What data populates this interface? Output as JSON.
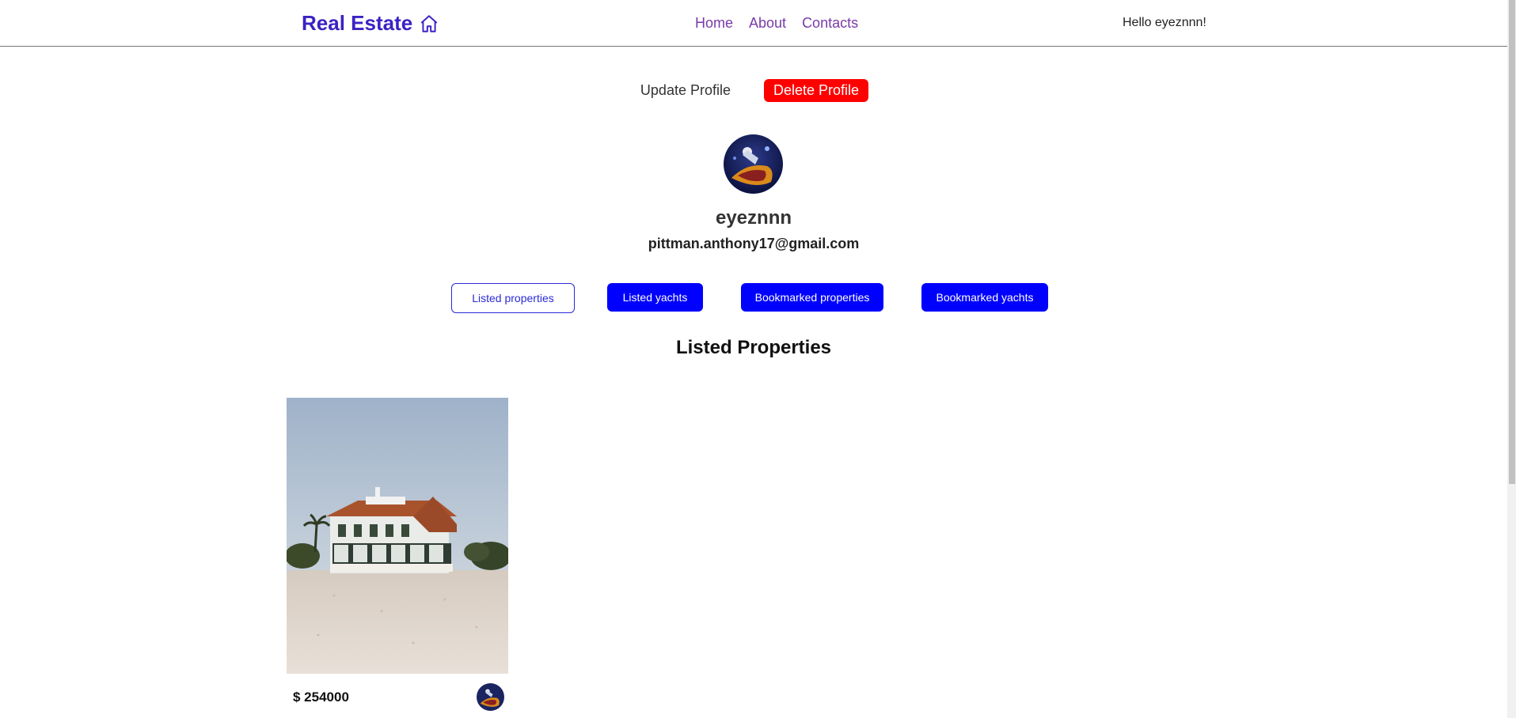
{
  "nav": {
    "brand": "Real Estate",
    "brand_icon": "home-icon",
    "links": [
      "Home",
      "About",
      "Contacts"
    ],
    "greeting": "Hello eyeznnn!"
  },
  "profile": {
    "update_label": "Update Profile",
    "delete_label": "Delete Profile",
    "username": "eyeznnn",
    "email": "pittman.anthony17@gmail.com"
  },
  "tabs": [
    "Listed properties",
    "Listed yachts",
    "Bookmarked properties",
    "Bookmarked yachts"
  ],
  "section_title": "Listed Properties",
  "listings": [
    {
      "price": "$ 254000"
    }
  ],
  "colors": {
    "brand": "#3a22c4",
    "nav_link": "#7a3aa8",
    "delete": "#ff0000",
    "tab_active": "#0000ff"
  }
}
